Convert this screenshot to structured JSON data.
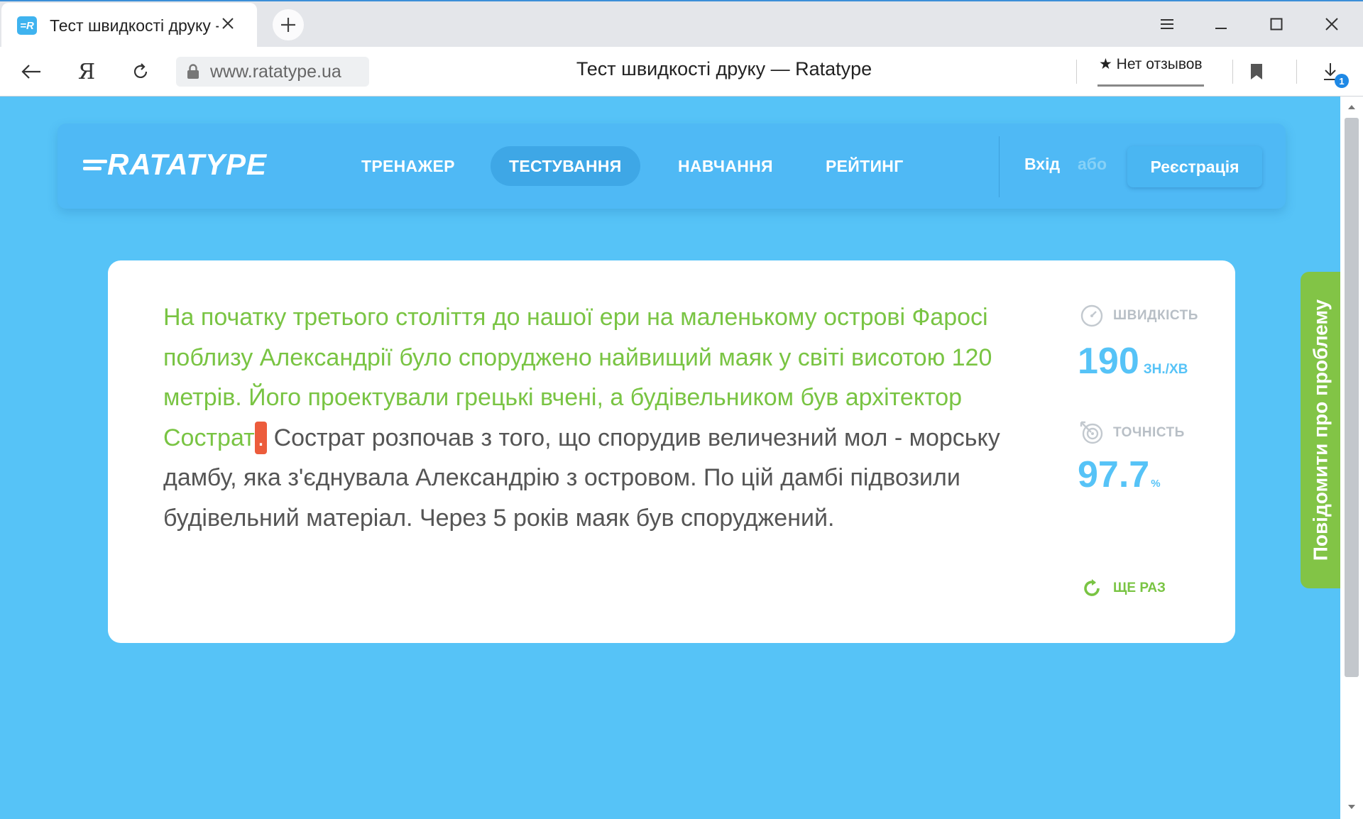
{
  "browser": {
    "tab_title": "Тест швидкості друку - Ratatype",
    "favicon_text": "=R",
    "url": "www.ratatype.ua",
    "page_title": "Тест швидкості друку — Ratatype",
    "reviews_label": "★ Нет отзывов",
    "downloads_badge": "1",
    "yandex_glyph": "Я"
  },
  "site": {
    "logo": "RATATYPE",
    "menu": [
      {
        "label": "ТРЕНАЖЕР",
        "active": false
      },
      {
        "label": "ТЕСТУВАННЯ",
        "active": true
      },
      {
        "label": "НАВЧАННЯ",
        "active": false
      },
      {
        "label": "РЕЙТИНГ",
        "active": false
      }
    ],
    "login": "Вхід",
    "or": "або",
    "register": "Реєстрація"
  },
  "test": {
    "typed_text": "На початку третього століття до нашої ери на маленькому острові Фаросі поблизу Александрії було споруджено найвищий маяк у світі висотою 120 метрів. Його проектували грецькі вчені, а будівельником був архітектор Сострат",
    "current_char": ".",
    "remaining_text": " Сострат розпочав з того, що спорудив величезний мол - морську дамбу, яка з'єднувала Александрію з островом. По цій дамбі підвозили будівельний матеріал. Через 5 років маяк був споруджений.",
    "speed_label": "ШВИДКІСТЬ",
    "speed_value": "190",
    "speed_unit": "ЗН./ХВ",
    "accuracy_label": "ТОЧНІСТЬ",
    "accuracy_value": "97.7",
    "accuracy_unit": "%",
    "retry_label": "ЩЕ РАЗ"
  },
  "feedback": {
    "label": "Повідомити про проблему"
  },
  "colors": {
    "page_bg": "#56c3f7",
    "typed": "#79c443",
    "cursor": "#ec5c3c",
    "stat_value": "#56c3f7",
    "feedback_bg": "#82c446"
  }
}
